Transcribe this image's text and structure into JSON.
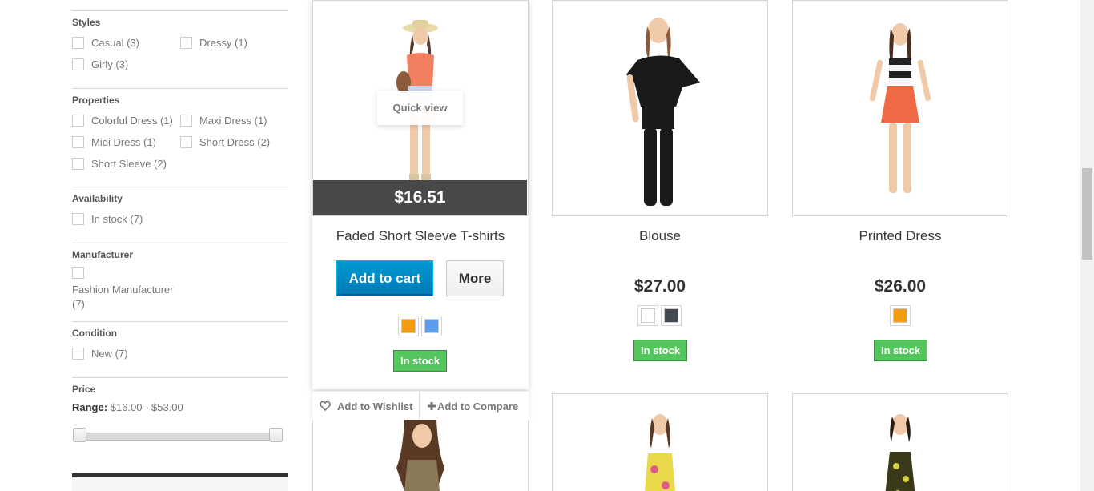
{
  "filters": {
    "styles": {
      "title": "Styles",
      "options": [
        "Casual (3)",
        "Dressy (1)",
        "Girly (3)"
      ]
    },
    "properties": {
      "title": "Properties",
      "options": [
        "Colorful Dress (1)",
        "Maxi Dress (1)",
        "Midi Dress (1)",
        "Short Dress (2)",
        "Short Sleeve (2)"
      ]
    },
    "availability": {
      "title": "Availability",
      "options": [
        "In stock (7)"
      ]
    },
    "manufacturer": {
      "title": "Manufacturer",
      "options": [
        "Fashion Manufacturer (7)"
      ]
    },
    "condition": {
      "title": "Condition",
      "options": [
        "New (7)"
      ]
    },
    "price": {
      "title": "Price",
      "range_label": "Range:",
      "range_value": "$16.00 - $53.00"
    }
  },
  "products": [
    {
      "name": "Faded Short Sleeve T-shirts",
      "price": "$16.51",
      "stock": "In stock",
      "colors": [
        "#f39c11",
        "#5d9cec"
      ]
    },
    {
      "name": "Blouse",
      "price": "$27.00",
      "stock": "In stock",
      "colors": [
        "#ffffff",
        "#434a54"
      ]
    },
    {
      "name": "Printed Dress",
      "price": "$26.00",
      "stock": "In stock",
      "colors": [
        "#f39c11"
      ]
    }
  ],
  "actions": {
    "quick_view": "Quick view",
    "add_to_cart": "Add to cart",
    "more": "More",
    "add_to_wishlist": "Add to Wishlist",
    "add_to_compare": "Add to Compare"
  }
}
